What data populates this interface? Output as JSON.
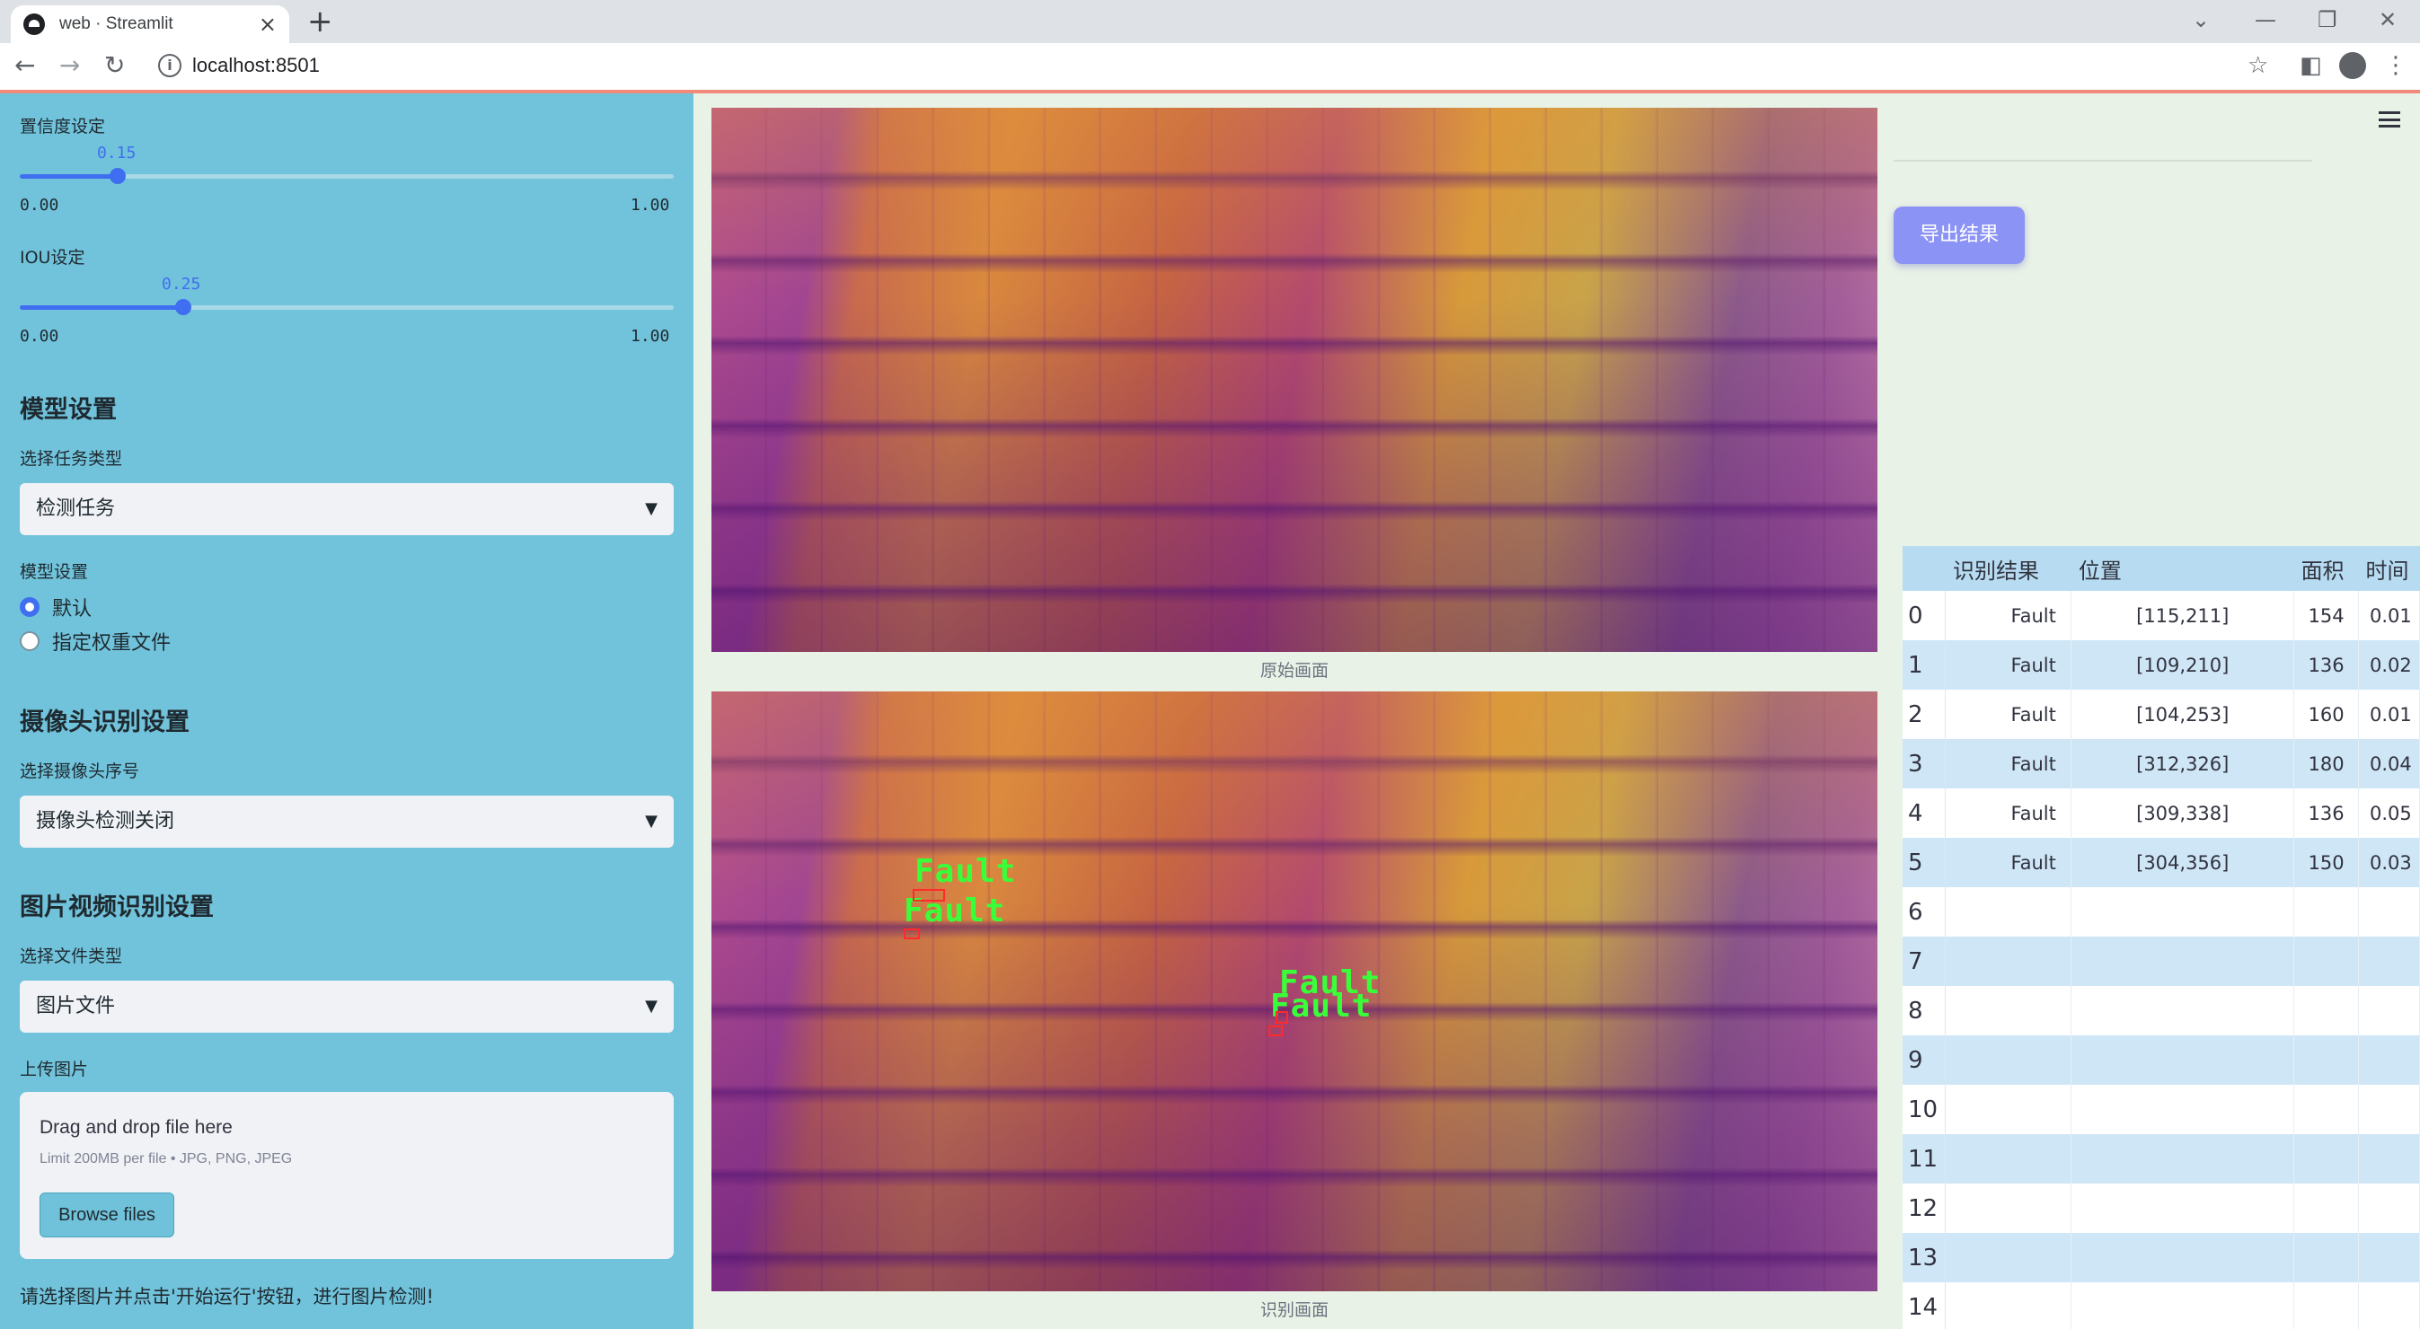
{
  "browser": {
    "tab_title": "web · Streamlit",
    "url": "localhost:8501"
  },
  "sidebar": {
    "confidence": {
      "label": "置信度设定",
      "value": "0.15",
      "min": "0.00",
      "max": "1.00",
      "fraction": 0.15
    },
    "iou": {
      "label": "IOU设定",
      "value": "0.25",
      "min": "0.00",
      "max": "1.00",
      "fraction": 0.25
    },
    "model_heading": "模型设置",
    "task_label": "选择任务类型",
    "task_value": "检测任务",
    "model_label": "模型设置",
    "model_options": [
      "默认",
      "指定权重文件"
    ],
    "model_selected": 0,
    "camera_heading": "摄像头识别设置",
    "camera_label": "选择摄像头序号",
    "camera_value": "摄像头检测关闭",
    "media_heading": "图片视频识别设置",
    "filetype_label": "选择文件类型",
    "filetype_value": "图片文件",
    "upload_label": "上传图片",
    "upload_title": "Drag and drop file here",
    "upload_limit": "Limit 200MB per file • JPG, PNG, JPEG",
    "browse_label": "Browse files",
    "note": "请选择图片并点击'开始运行'按钮，进行图片检测!"
  },
  "main": {
    "original_caption": "原始画面",
    "detected_caption": "识别画面",
    "detections": [
      "Fault",
      "Fault",
      "Fault",
      "Fault"
    ]
  },
  "right": {
    "export_label": "导出结果",
    "table": {
      "headers": [
        "",
        "识别结果",
        "位置",
        "面积",
        "时间"
      ],
      "rows": [
        [
          "0",
          "Fault",
          "[115,211]",
          "154",
          "0.01"
        ],
        [
          "1",
          "Fault",
          "[109,210]",
          "136",
          "0.02"
        ],
        [
          "2",
          "Fault",
          "[104,253]",
          "160",
          "0.01"
        ],
        [
          "3",
          "Fault",
          "[312,326]",
          "180",
          "0.04"
        ],
        [
          "4",
          "Fault",
          "[309,338]",
          "136",
          "0.05"
        ],
        [
          "5",
          "Fault",
          "[304,356]",
          "150",
          "0.03"
        ],
        [
          "6",
          "",
          "",
          "",
          ""
        ],
        [
          "7",
          "",
          "",
          "",
          ""
        ],
        [
          "8",
          "",
          "",
          "",
          ""
        ],
        [
          "9",
          "",
          "",
          "",
          ""
        ],
        [
          "10",
          "",
          "",
          "",
          ""
        ],
        [
          "11",
          "",
          "",
          "",
          ""
        ],
        [
          "12",
          "",
          "",
          "",
          ""
        ],
        [
          "13",
          "",
          "",
          "",
          ""
        ],
        [
          "14",
          "",
          "",
          "",
          ""
        ]
      ]
    }
  }
}
